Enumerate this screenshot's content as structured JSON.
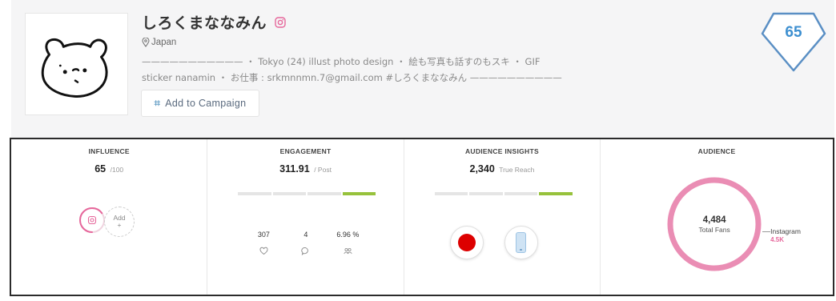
{
  "profile": {
    "name": "しろくまななみん",
    "network_icon": "instagram-icon",
    "location_icon": "map-pin-icon",
    "location": "Japan",
    "bio_line1": "——————————— ・ Tokyo (24) illust photo design ・ 絵も写真も話すのもスキ ・ GIF",
    "bio_line2": "sticker nanamin ・ お仕事 : srkmnnmn.7@gmail.com #しろくまななみん ——————————",
    "campaign_icon": "hashtag-icon",
    "campaign_label": "Add to Campaign",
    "score": "65"
  },
  "stats": {
    "influence": {
      "title": "INFLUENCE",
      "value": "65",
      "sub": "/100",
      "add_label": "Add",
      "add_plus": "+",
      "ring_fraction": 0.65
    },
    "engagement": {
      "title": "ENGAGEMENT",
      "value": "311.91",
      "sub": "/ Post",
      "bar_active_segment": 4,
      "metrics": [
        {
          "value": "307",
          "icon": "heart-icon"
        },
        {
          "value": "4",
          "icon": "comment-icon"
        },
        {
          "value": "6.96 %",
          "icon": "audience-icon"
        }
      ]
    },
    "audience_insights": {
      "title": "AUDIENCE INSIGHTS",
      "value": "2,340",
      "sub": "True Reach",
      "bar_active_segment": 4,
      "country_icon": "japan-flag-icon",
      "device_icon": "mobile-phone-icon"
    },
    "audience": {
      "title": "AUDIENCE",
      "total": "4,484",
      "total_label": "Total Fans",
      "legend_name": "Instagram",
      "legend_value": "4.5K"
    }
  },
  "colors": {
    "accent_blue": "#3d8fd0",
    "instagram_pink": "#e6679b",
    "engagement_green": "#97c23c",
    "japan_red": "#dd0000"
  }
}
